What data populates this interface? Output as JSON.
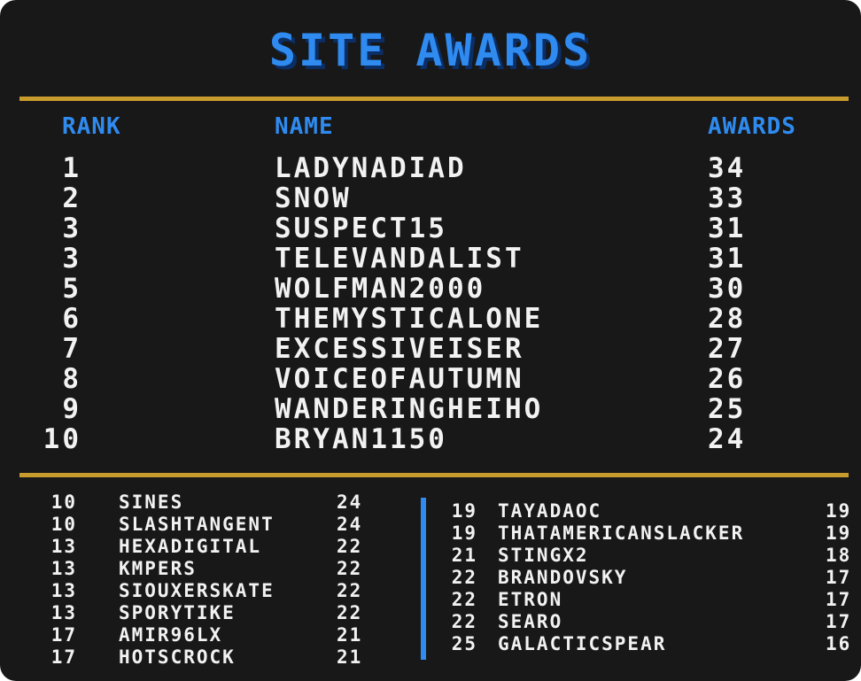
{
  "title": "SITE AWARDS",
  "headers": {
    "rank": "RANK",
    "name": "NAME",
    "awards": "AWARDS"
  },
  "colors": {
    "background": "#181818",
    "accent_blue": "#2f8bf0",
    "gold_rule": "#c89b2d",
    "text": "#f2f2f2"
  },
  "top_ten": [
    {
      "rank": "1",
      "name": "LADYNADIAD",
      "awards": "34"
    },
    {
      "rank": "2",
      "name": "SNOW",
      "awards": "33"
    },
    {
      "rank": "3",
      "name": "SUSPECT15",
      "awards": "31"
    },
    {
      "rank": "3",
      "name": "TELEVANDALIST",
      "awards": "31"
    },
    {
      "rank": "5",
      "name": "WOLFMAN2000",
      "awards": "30"
    },
    {
      "rank": "6",
      "name": "THEMYSTICALONE",
      "awards": "28"
    },
    {
      "rank": "7",
      "name": "EXCESSIVEISER",
      "awards": "27"
    },
    {
      "rank": "8",
      "name": "VOICEOFAUTUMN",
      "awards": "26"
    },
    {
      "rank": "9",
      "name": "WANDERINGHEIHO",
      "awards": "25"
    },
    {
      "rank": "10",
      "name": "BRYAN1150",
      "awards": "24"
    }
  ],
  "left_list": [
    {
      "rank": "10",
      "name": "SINES",
      "awards": "24"
    },
    {
      "rank": "10",
      "name": "SLASHTANGENT",
      "awards": "24"
    },
    {
      "rank": "13",
      "name": "HEXADIGITAL",
      "awards": "22"
    },
    {
      "rank": "13",
      "name": "KMPERS",
      "awards": "22"
    },
    {
      "rank": "13",
      "name": "SIOUXERSKATE",
      "awards": "22"
    },
    {
      "rank": "13",
      "name": "SPORYTIKE",
      "awards": "22"
    },
    {
      "rank": "17",
      "name": "AMIR96LX",
      "awards": "21"
    },
    {
      "rank": "17",
      "name": "HOTSCROCK",
      "awards": "21"
    }
  ],
  "right_list": [
    {
      "rank": "19",
      "name": "TAYADAOC",
      "awards": "19"
    },
    {
      "rank": "19",
      "name": "THATAMERICANSLACKER",
      "awards": "19"
    },
    {
      "rank": "21",
      "name": "STINGX2",
      "awards": "18"
    },
    {
      "rank": "22",
      "name": "BRANDOVSKY",
      "awards": "17"
    },
    {
      "rank": "22",
      "name": "ETRON",
      "awards": "17"
    },
    {
      "rank": "22",
      "name": "SEARO",
      "awards": "17"
    },
    {
      "rank": "25",
      "name": "GALACTICSPEAR",
      "awards": "16"
    }
  ]
}
